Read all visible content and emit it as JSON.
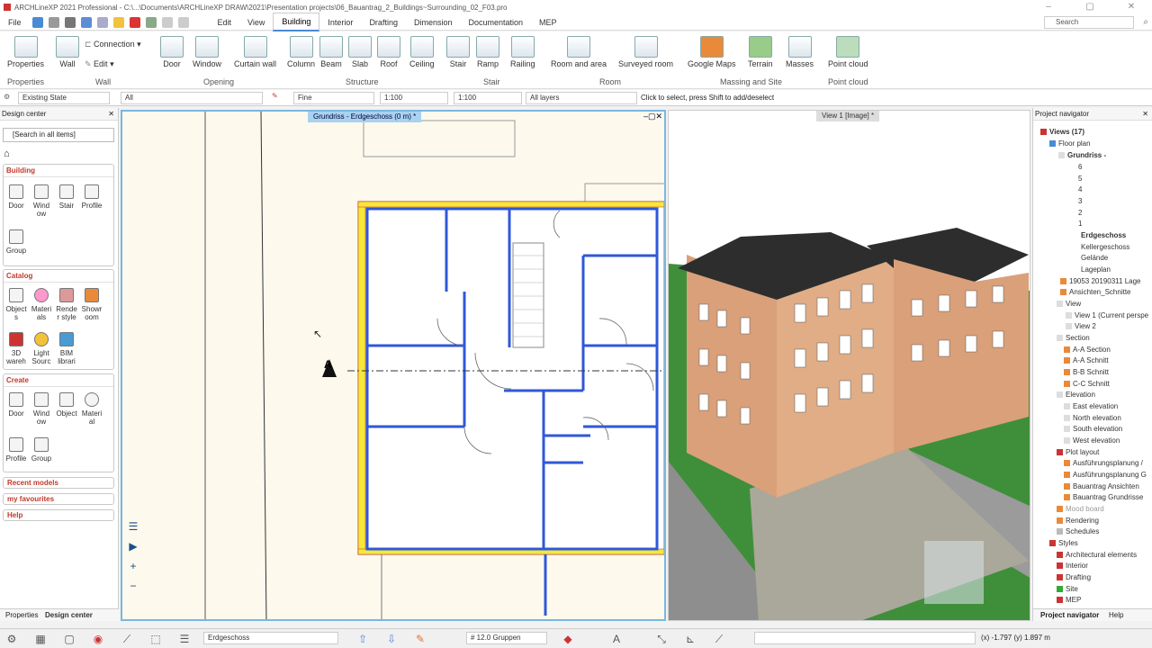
{
  "title": "ARCHLineXP 2021 Professional - C:\\...\\Documents\\ARCHLineXP DRAW\\2021\\Presentation projects\\06_Bauantrag_2_Buildings~Surrounding_02_F03.pro",
  "menu": {
    "file": "File",
    "edit": "Edit",
    "view": "View",
    "building": "Building",
    "interior": "Interior",
    "drafting": "Drafting",
    "dimension": "Dimension",
    "documentation": "Documentation",
    "mep": "MEP"
  },
  "search_placeholder": "Search",
  "ribbon": {
    "properties": "Properties",
    "wall": "Wall",
    "connection": "Connection",
    "edit": "Edit",
    "door": "Door",
    "window": "Window",
    "curtain_wall": "Curtain wall",
    "column": "Column",
    "beam": "Beam",
    "slab": "Slab",
    "roof": "Roof",
    "ceiling": "Ceiling",
    "stair": "Stair",
    "ramp": "Ramp",
    "railing": "Railing",
    "room_and_area": "Room and area",
    "surveyed_room": "Surveyed room",
    "google_maps": "Google Maps",
    "terrain": "Terrain",
    "masses": "Masses",
    "point_cloud": "Point cloud",
    "groups": {
      "properties": "Properties",
      "wall": "Wall",
      "opening": "Opening",
      "structure": "Structure",
      "stair": "Stair",
      "room": "Room",
      "massing": "Massing and Site",
      "point_cloud": "Point cloud"
    }
  },
  "options": {
    "state": "Existing State",
    "all": "All",
    "fine": "Fine",
    "scale1": "1:100",
    "scale2": "1:100",
    "layers": "All layers",
    "hint": "Click to select, press Shift to add/deselect"
  },
  "design_center": {
    "title": "Design center",
    "search": "[Search in all items]",
    "building": {
      "title": "Building",
      "items": [
        "Door",
        "Wind ow",
        "Stair",
        "Profile",
        "Group"
      ]
    },
    "catalog": {
      "title": "Catalog",
      "items": [
        "Object s",
        "Materi als",
        "Rende r style",
        "Showr oom",
        "3D wareh",
        "Light Sourc",
        "BIM librari"
      ]
    },
    "create": {
      "title": "Create",
      "items": [
        "Door",
        "Wind ow",
        "Object",
        "Materi al",
        "Profile",
        "Group"
      ]
    },
    "recent": "Recent models",
    "favourites": "my favourites",
    "help": "Help"
  },
  "view1": {
    "tab": "Grundriss - Erdgeschoss (0 m) *",
    "marker": "A"
  },
  "view2": {
    "tab": "View 1 [Image] *"
  },
  "navigator": {
    "title": "Project navigator",
    "tree": [
      "Views (17)",
      "Floor plan",
      "Grundriss -",
      "6",
      "5",
      "4",
      "3",
      "2",
      "1",
      "Erdgeschoss",
      "Kellergeschoss",
      "Gelände",
      "Lageplan",
      "19053 20190311 Lage",
      "Ansichten_Schnitte",
      "View",
      "View 1 (Current perspe",
      "View 2",
      "Section",
      "A-A Section",
      "A-A Schnitt",
      "B-B Schnitt",
      "C-C Schnitt",
      "Elevation",
      "East elevation",
      "North elevation",
      "South elevation",
      "West elevation",
      "Plot layout",
      "Ausführungsplanung /",
      "Ausführungsplanung G",
      "Bauantrag Ansichten",
      "Bauantrag Grundrisse",
      "Mood board",
      "Rendering",
      "Schedules",
      "Styles",
      "Architectural elements",
      "Interior",
      "Drafting",
      "Site",
      "MEP"
    ],
    "help": "Help"
  },
  "bottom_tabs": {
    "properties": "Properties",
    "design_center": "Design center"
  },
  "status": {
    "level": "Erdgeschoss",
    "groups": "# 12.0 Gruppen",
    "coords": "(x) -1.797  (y) 1.897 m"
  }
}
